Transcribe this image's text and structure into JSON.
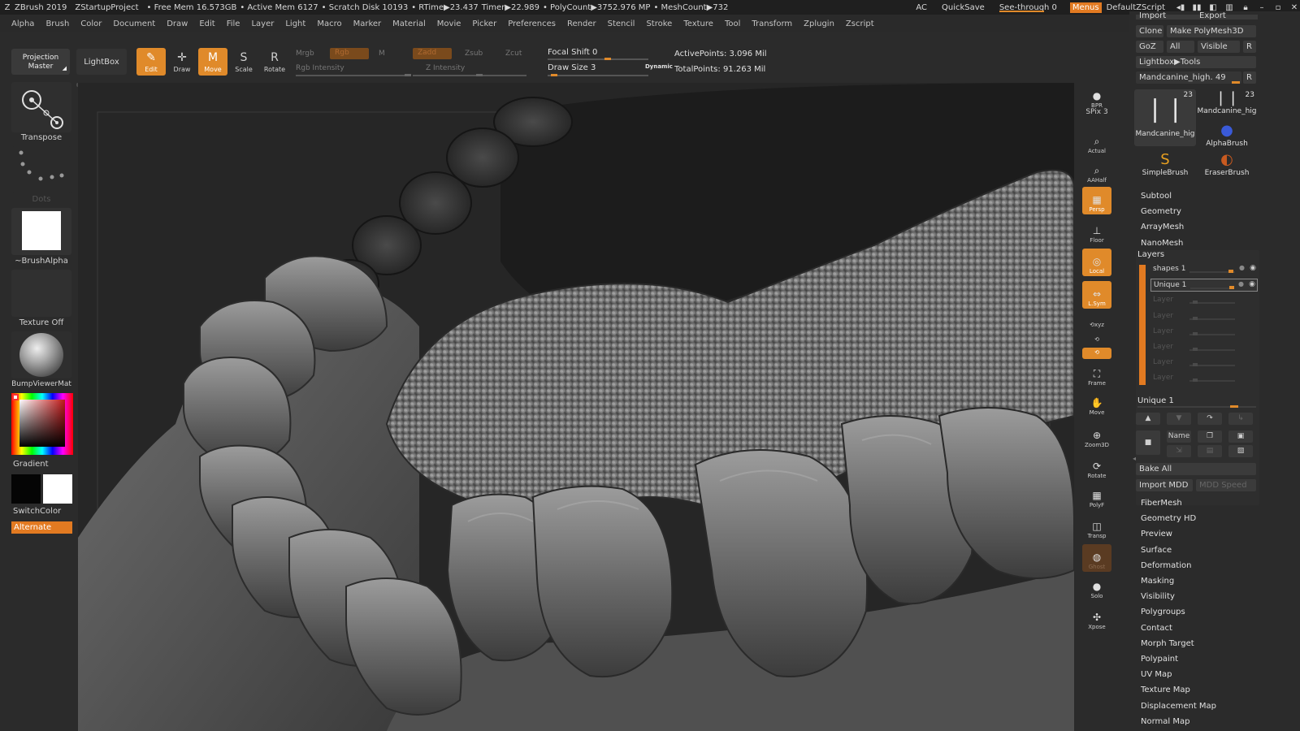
{
  "titlebar": {
    "app": "ZBrush 2019",
    "project": "ZStartupProject",
    "free_mem": "• Free Mem 16.573GB",
    "active_mem": "• Active Mem 6127",
    "scratch": "• Scratch Disk 10193",
    "rtime": "• RTime▶23.437",
    "timer": "Timer▶22.989",
    "polycount": "• PolyCount▶3752.976 MP",
    "meshcount": "• MeshCount▶732",
    "ac": "AC",
    "quicksave": "QuickSave",
    "see_through": "See-through  0",
    "menus": "Menus",
    "script": "DefaultZScript"
  },
  "menubar": [
    "Alpha",
    "Brush",
    "Color",
    "Document",
    "Draw",
    "Edit",
    "File",
    "Layer",
    "Light",
    "Macro",
    "Marker",
    "Material",
    "Movie",
    "Picker",
    "Preferences",
    "Render",
    "Stencil",
    "Stroke",
    "Texture",
    "Tool",
    "Transform",
    "Zplugin",
    "Zscript"
  ],
  "shelf": {
    "projection_master": "Projection Master",
    "lightbox": "LightBox",
    "tools": [
      {
        "label": "Edit",
        "icon": "edit-icon",
        "on": true
      },
      {
        "label": "Draw",
        "icon": "draw-icon",
        "on": false
      },
      {
        "label": "Move",
        "icon": "move-icon",
        "on": true
      },
      {
        "label": "Scale",
        "icon": "scale-icon",
        "on": false
      },
      {
        "label": "Rotate",
        "icon": "rotate-icon",
        "on": false
      }
    ],
    "mrgb": "Mrgb",
    "rgb": "Rgb",
    "m": "M",
    "rgb_intensity": "Rgb Intensity",
    "zadd": "Zadd",
    "zsub": "Zsub",
    "zcut": "Zcut",
    "z_intensity": "Z Intensity",
    "focal_shift": "Focal Shift 0",
    "draw_size": "Draw Size 3",
    "dynamic": "Dynamic",
    "active_points": "ActivePoints: 3.096 Mil",
    "total_points": "TotalPoints: 91.263 Mil"
  },
  "lefttray": {
    "transpose": "Transpose",
    "dots": "Dots",
    "brush_alpha": "~BrushAlpha",
    "texture_off": "Texture Off",
    "material": "BumpViewerMat",
    "gradient": "Gradient",
    "switch_color": "SwitchColor",
    "alternate": "Alternate"
  },
  "rshelf": [
    {
      "label": "BPR",
      "icon": "bpr-sphere-icon",
      "state": "normal"
    },
    {
      "label": "SPix 3",
      "icon": "spix-icon",
      "state": "text"
    },
    {
      "label": "Actual",
      "icon": "actual-icon",
      "state": "normal"
    },
    {
      "label": "AAHalf",
      "icon": "aahalf-icon",
      "state": "normal"
    },
    {
      "label": "Persp",
      "icon": "persp-icon",
      "state": "on"
    },
    {
      "label": "Floor",
      "icon": "floor-icon",
      "state": "normal"
    },
    {
      "label": "Local",
      "icon": "local-icon",
      "state": "on"
    },
    {
      "label": "L.Sym",
      "icon": "lsym-icon",
      "state": "on"
    },
    {
      "label": "Frame",
      "icon": "frame-icon",
      "state": "normal"
    },
    {
      "label": "Move",
      "icon": "hand-move-icon",
      "state": "normal"
    },
    {
      "label": "Zoom3D",
      "icon": "zoom3d-icon",
      "state": "normal"
    },
    {
      "label": "Rotate",
      "icon": "rotate3d-icon",
      "state": "normal"
    },
    {
      "label": "PolyF",
      "icon": "polyf-icon",
      "state": "normal"
    },
    {
      "label": "Transp",
      "icon": "transp-icon",
      "state": "normal"
    },
    {
      "label": "Ghost",
      "icon": "ghost-icon",
      "state": "dim"
    },
    {
      "label": "Solo",
      "icon": "solo-icon",
      "state": "normal"
    },
    {
      "label": "Xpose",
      "icon": "xpose-icon",
      "state": "normal"
    }
  ],
  "rpanel": {
    "import": "Import",
    "export": "Export",
    "clone": "Clone",
    "make_polymesh": "Make PolyMesh3D",
    "goz": "GoZ",
    "all": "All",
    "visible": "Visible",
    "r": "R",
    "lightbox_tools": "Lightbox▶Tools",
    "current_tool": "Mandcanine_high. 49",
    "brushes": [
      {
        "name": "Mandcanine_hig",
        "icon": "canine-icon",
        "count": "23"
      },
      {
        "name": "Mandcanine_hig",
        "icon": "canine-icon",
        "count": "23"
      },
      {
        "name": "AlphaBrush",
        "icon": "alphabrush-icon",
        "count": ""
      },
      {
        "name": "SimpleBrush",
        "icon": "simplebrush-icon",
        "count": ""
      },
      {
        "name": "EraserBrush",
        "icon": "eraserbrush-icon",
        "count": ""
      }
    ],
    "sections_top": [
      "Subtool",
      "Geometry",
      "ArrayMesh",
      "NanoMesh"
    ],
    "layers_title": "Layers",
    "layers": [
      "shapes 1",
      "Unique 1",
      "Layer",
      "Layer",
      "Layer",
      "Layer",
      "Layer",
      "Layer"
    ],
    "unique_slider": "Unique 1",
    "name": "Name",
    "bake_all": "Bake All",
    "import_mdd": "Import MDD",
    "mdd_speed": "MDD Speed",
    "sections_bottom": [
      "FiberMesh",
      "Geometry HD",
      "Preview",
      "Surface",
      "Deformation",
      "Masking",
      "Visibility",
      "Polygroups",
      "Contact",
      "Morph Target",
      "Polypaint",
      "UV Map",
      "Texture Map",
      "Displacement Map",
      "Normal Map"
    ]
  }
}
